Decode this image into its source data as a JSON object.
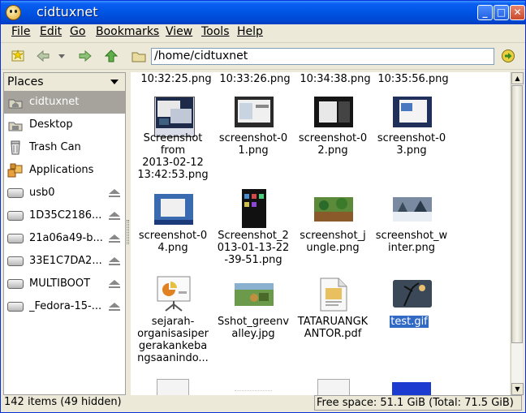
{
  "window": {
    "title": "cidtuxnet"
  },
  "menubar": [
    "File",
    "Edit",
    "Go",
    "Bookmarks",
    "View",
    "Tools",
    "Help"
  ],
  "toolbar": {
    "location": "/home/cidtuxnet"
  },
  "sidebar": {
    "header": "Places",
    "items": [
      {
        "label": "cidtuxnet",
        "icon": "home-icon",
        "selected": true
      },
      {
        "label": "Desktop",
        "icon": "desktop-icon"
      },
      {
        "label": "Trash Can",
        "icon": "trash-icon"
      },
      {
        "label": "Applications",
        "icon": "applications-icon"
      },
      {
        "label": "usb0",
        "icon": "drive-icon",
        "eject": true
      },
      {
        "label": "1D35C2186...",
        "icon": "drive-icon",
        "eject": true
      },
      {
        "label": "21a06a49-b...",
        "icon": "drive-icon",
        "eject": true
      },
      {
        "label": "33E1C7DA2...",
        "icon": "drive-icon",
        "eject": true
      },
      {
        "label": "MULTIBOOT",
        "icon": "drive-icon",
        "eject": true
      },
      {
        "label": "_Fedora-15-...",
        "icon": "drive-icon",
        "eject": true
      }
    ]
  },
  "files": {
    "partial_top_row": [
      "10:32:25.png",
      "10:33:26.png",
      "10:34:38.png",
      "10:35:56.png"
    ],
    "row1": [
      {
        "name": "Screenshot from 2013-02-12 13:42:53.png",
        "lines": [
          "Screenshot",
          "from",
          "2013-02-12",
          "13:42:53.png"
        ]
      },
      {
        "name": "screenshot-01.png",
        "lines": [
          "screenshot-0",
          "1.png"
        ]
      },
      {
        "name": "screenshot-02.png",
        "lines": [
          "screenshot-0",
          "2.png"
        ]
      },
      {
        "name": "screenshot-03.png",
        "lines": [
          "screenshot-0",
          "3.png"
        ]
      }
    ],
    "row2": [
      {
        "name": "screenshot-04.png",
        "lines": [
          "screenshot-0",
          "4.png"
        ]
      },
      {
        "name": "Screenshot_2013-01-13-22-39-51.png",
        "lines": [
          "Screenshot_2",
          "013-01-13-22",
          "-39-51.png"
        ]
      },
      {
        "name": "screenshot_jungle.png",
        "lines": [
          "screenshot_j",
          "ungle.png"
        ]
      },
      {
        "name": "screenshot_winter.png",
        "lines": [
          "screenshot_w",
          "inter.png"
        ]
      }
    ],
    "row3": [
      {
        "name": "sejarah-organisasipergerakankebangsaanindo...",
        "lines": [
          "sejarah-",
          "organisasiper",
          "gerakankeba",
          "ngsaanindo..."
        ]
      },
      {
        "name": "Sshot_greenvalley.jpg",
        "lines": [
          "Sshot_greenv",
          "alley.jpg"
        ]
      },
      {
        "name": "TATARUANGKANTOR.pdf",
        "lines": [
          "TATARUANGK",
          "ANTOR.pdf"
        ]
      },
      {
        "name": "test.gif",
        "lines": [
          "test.gif"
        ],
        "selected": true
      }
    ]
  },
  "statusbar": {
    "items": "142 items (49 hidden)",
    "free_space": "Free space: 51.1 GiB (Total: 71.5 GiB)"
  }
}
